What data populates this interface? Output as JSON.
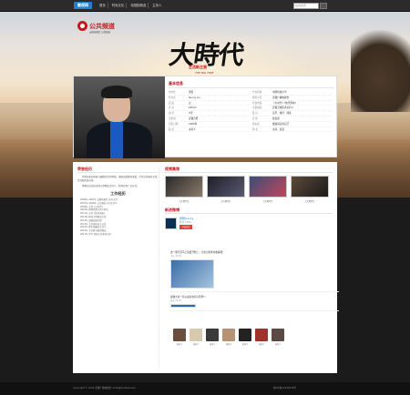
{
  "topbar": {
    "logo": "徽视网",
    "nav": [
      "首页",
      "时尚文化",
      "电视剧精选",
      "主持人"
    ],
    "search_placeholder": "站内检索"
  },
  "hero": {
    "channel": "公共频道",
    "channel_sub": "安徽电视台 公共频道",
    "show_title": "大時代",
    "show_sub": "生活新主張",
    "show_sub2": "THE BIG TIME"
  },
  "profile": {
    "title": "基本信息",
    "left_rows": [
      {
        "k": "中文名",
        "v": "张阳"
      },
      {
        "k": "外文名",
        "v": "Sunny Liu"
      },
      {
        "k": "民 族",
        "v": "汉"
      },
      {
        "k": "身 高",
        "v": "182cm"
      },
      {
        "k": "血 型",
        "v": "O型"
      },
      {
        "k": "出生地",
        "v": "安徽合肥"
      },
      {
        "k": "出生日期",
        "v": "1985年"
      },
      {
        "k": "职 业",
        "v": "主持人"
      }
    ],
    "right_rows": [
      {
        "k": "毕业院校",
        "v": "中国传媒大学"
      },
      {
        "k": "经纪公司",
        "v": "安徽广播电视台"
      },
      {
        "k": "代表作品",
        "v": "《大时代》《快乐周末》"
      },
      {
        "k": "主要成就",
        "v": "安徽卫视优秀主持人"
      },
      {
        "k": "爱 好",
        "v": "音乐、旅行、阅读"
      },
      {
        "k": "星 座",
        "v": "处女座"
      },
      {
        "k": "座右铭",
        "v": "做最真实的自己"
      },
      {
        "k": "特 长",
        "v": "主持、表演"
      }
    ]
  },
  "left_col": {
    "title": "荣誉经历",
    "bio": [
      "凭借亲和的形象与幽默的主持风格，张阳深受观众喜爱，主持过多档综艺及生活服务类节目。",
      "他曾先后担任多场大型晚会主持人，获得业界广泛认可。"
    ],
    "exp_title": "工作经历",
    "exp_items": [
      "2006年-2007年 安徽电视台 实习主持",
      "2007年-2009年 公共频道 节目主持人",
      "2009年 主持《大时代》",
      "2010年 获得优秀主持人称号",
      "2011年 主持《快乐周末》",
      "2012年 担任大型晚会主持",
      "2013年 加盟安徽卫视",
      "2014年 主持多档综艺节目",
      "2015年 获年度最佳主持人",
      "2016年 主持春节联欢晚会",
      "2017年 至今 持续主持多档节目"
    ]
  },
  "right_col": {
    "video_title": "视频集锦",
    "videos": [
      "《大时代》",
      "《大时代》",
      "《大时代》",
      "《大时代》"
    ],
    "weibo_title": "新浪微博",
    "weibo_name": "张阳Sunny",
    "weibo_count": "粉丝 1366",
    "follow": "+加关注",
    "feed": [
      {
        "text": "这一期节目马上就要开始了，大家记得准时收看哦！",
        "meta": "今天 19:30"
      },
      {
        "text": "感谢大家一直以来的支持与陪伴～",
        "meta": "昨天 21:10"
      }
    ]
  },
  "fans": [
    "粉丝1",
    "粉丝2",
    "粉丝3",
    "粉丝4",
    "粉丝5",
    "粉丝6",
    "粉丝7"
  ],
  "footer": {
    "copy": "Copyright © 2016 安徽广播电视台 All Rights Reserved",
    "beian": "皖ICP备12345678号"
  },
  "colors": {
    "accent": "#c9151e",
    "link": "#1976d2"
  }
}
